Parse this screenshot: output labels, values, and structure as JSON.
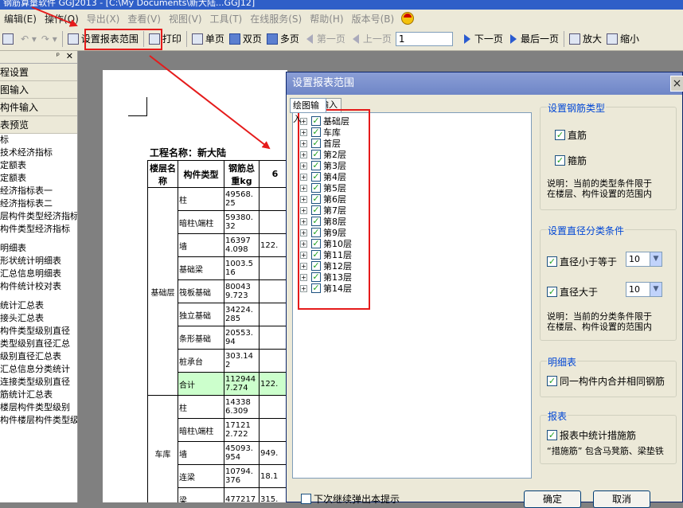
{
  "window": {
    "title": "钢筋算量软件 GGJ2013  -  [C:\\My Documents\\新大陆...GGJ12]"
  },
  "menu": [
    "编辑(E)",
    "操作(O)",
    "导出(X)",
    "查看(V)",
    "视图(V)",
    "工具(T)",
    "在线服务(S)",
    "帮助(H)",
    "版本号(B)"
  ],
  "toolbar": {
    "set_range": "设置报表范围",
    "print": "打印",
    "single_page": "单页",
    "double_page": "双页",
    "multi_page": "多页",
    "first_page": "第一页",
    "prev_page": "上一页",
    "page_number": "1",
    "next_page": "下一页",
    "last_page": "最后一页",
    "zoom_in": "放大",
    "zoom_out": "缩小"
  },
  "sidebar": {
    "sections": [
      "程设置",
      "图输入",
      "构件输入",
      "表预览"
    ],
    "items": [
      "标",
      "技术经济指标",
      "定额表",
      "定额表",
      "经济指标表一",
      "经济指标表二",
      "层构件类型经济指标",
      "构件类型经济指标",
      "",
      "明细表",
      "形状统计明细表",
      "汇总信息明细表",
      "构件统计校对表",
      "",
      "统计汇总表",
      "接头汇总表",
      "构件类型级别直径",
      "类型级别直径汇总",
      "级别直径汇总表",
      "汇总信息分类统计",
      "连接类型级别直径",
      "筋统计汇总表",
      "楼层构件类型级别",
      "构件楼层构件类型级"
    ]
  },
  "report": {
    "project_label": "工程名称：新大陆",
    "headers": {
      "floor": "楼层名称",
      "type": "构件类型",
      "total": "钢筋总重kg",
      "col6": "6"
    },
    "groups": [
      {
        "floor": "基础层",
        "rows": [
          {
            "type": "柱",
            "total": "49568.25",
            "c6": ""
          },
          {
            "type": "暗柱\\端柱",
            "total": "59380.32",
            "c6": ""
          },
          {
            "type": "墙",
            "total": "163974.098",
            "c6": "122."
          },
          {
            "type": "基础梁",
            "total": "1003.516",
            "c6": ""
          },
          {
            "type": "筏板基础",
            "total": "800439.723",
            "c6": ""
          },
          {
            "type": "独立基础",
            "total": "34224.285",
            "c6": ""
          },
          {
            "type": "条形基础",
            "total": "20553.94",
            "c6": ""
          },
          {
            "type": "桩承台",
            "total": "303.142",
            "c6": ""
          },
          {
            "type": "合计",
            "total": "1129447.274",
            "c6": "122."
          }
        ]
      },
      {
        "floor": "车库",
        "rows": [
          {
            "type": "柱",
            "total": "143386.309",
            "c6": ""
          },
          {
            "type": "暗柱\\端柱",
            "total": "171212.722",
            "c6": ""
          },
          {
            "type": "墙",
            "total": "45093.954",
            "c6": "949."
          },
          {
            "type": "连梁",
            "total": "10794.376",
            "c6": "18.1"
          },
          {
            "type": "梁",
            "total": "477217",
            "c6": "315."
          }
        ]
      }
    ]
  },
  "dialog": {
    "title": "设置报表范围",
    "close": "×",
    "tabs": [
      "绘图输入",
      "单构件输入"
    ],
    "floors": [
      "基础层",
      "车库",
      "首层",
      "第2层",
      "第3层",
      "第4层",
      "第5层",
      "第6层",
      "第7层",
      "第8层",
      "第9层",
      "第10层",
      "第11层",
      "第12层",
      "第13层",
      "第14层"
    ],
    "rebar_type": {
      "title": "设置钢筋类型",
      "straight": "直筋",
      "stirrup": "箍筋",
      "note1": "说明：当前的类型条件限于",
      "note2": "在楼层、构件设置的范围内"
    },
    "diameter": {
      "title": "设置直径分类条件",
      "le_label": "直径小于等于",
      "le_value": "10",
      "gt_label": "直径大于",
      "gt_value": "10",
      "note1": "说明：当前的分类条件限于",
      "note2": "在楼层、构件设置的范围内"
    },
    "detail": {
      "title": "明细表",
      "merge": "同一构件内合并相同钢筋"
    },
    "report": {
      "title": "报表",
      "measure": "报表中统计措施筋",
      "note": "“措施筋” 包含马凳筋、梁垫铁"
    },
    "next_popup": "下次继续弹出本提示",
    "ok": "确定",
    "cancel": "取消"
  },
  "colors": {
    "highlight": "#e51b1b",
    "group_title": "#0046d5",
    "total_row": "#ccffcc"
  }
}
